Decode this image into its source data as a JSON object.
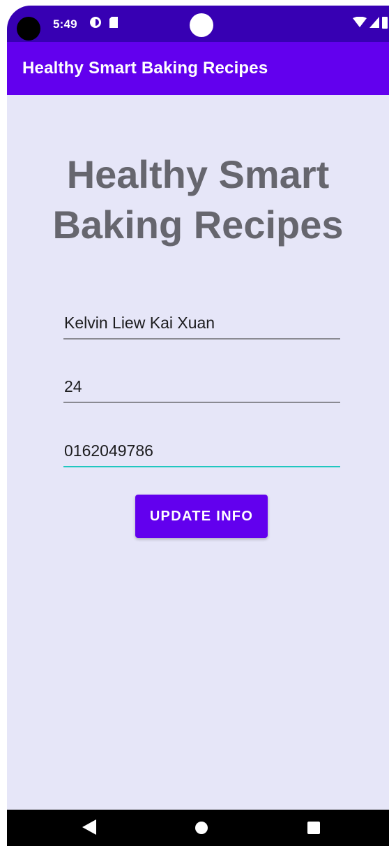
{
  "status_bar": {
    "time": "5:49",
    "icons_left": [
      "sync-icon",
      "sd-card-icon"
    ],
    "icons_right": [
      "wifi-icon",
      "signal-icon",
      "battery-icon"
    ]
  },
  "app_bar": {
    "title": "Healthy Smart Baking Recipes"
  },
  "main": {
    "heading_line1": "Healthy Smart",
    "heading_line2": "Baking Recipes",
    "fields": [
      {
        "value": "Kelvin Liew Kai Xuan"
      },
      {
        "value": "24"
      },
      {
        "value": "0162049786"
      }
    ],
    "update_button_label": "UPDATE INFO"
  },
  "nav_bar": {
    "icons": [
      "back-icon",
      "home-icon",
      "recents-icon"
    ]
  },
  "colors": {
    "primary": "#6200ee",
    "primary_dark": "#3700b3",
    "background": "#e6e6f8",
    "heading": "#66666e",
    "focus_accent": "#21c7c0"
  }
}
